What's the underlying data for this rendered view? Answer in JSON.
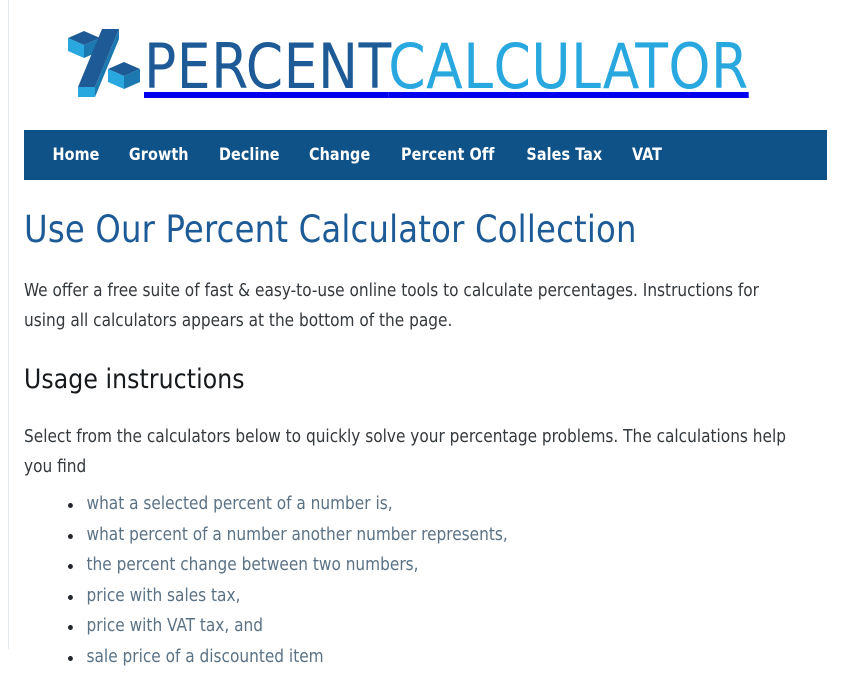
{
  "site": {
    "logo": {
      "icon": "percent-3d-icon",
      "word_primary": "PERCENT",
      "word_secondary": "CALCULATOR",
      "color_primary": "#1e5b96",
      "color_secondary": "#29a8df",
      "icon_top_color": "#1e5b96",
      "icon_side_color": "#29a8df"
    }
  },
  "nav": {
    "background": "#0f5288",
    "items": [
      {
        "label": "Home"
      },
      {
        "label": "Growth"
      },
      {
        "label": "Decline"
      },
      {
        "label": "Change"
      },
      {
        "label": "Percent Off"
      },
      {
        "label": "Sales Tax"
      },
      {
        "label": "VAT"
      }
    ]
  },
  "main": {
    "page_title": "Use Our Percent Calculator Collection",
    "page_title_color": "#1d5b96",
    "intro_paragraph": "We offer a free suite of fast & easy-to-use online tools to calculate percentages. Instructions for using all calculators appears at the bottom of the page.",
    "usage_heading": "Usage instructions",
    "select_paragraph": "Select from the calculators below to quickly solve your percentage problems. The calculations help you find",
    "usage_list": [
      {
        "label": "what a selected percent of a number is,"
      },
      {
        "label": "what percent of a number another number represents,"
      },
      {
        "label": "the percent change between two numbers,"
      },
      {
        "label": "price with sales tax,"
      },
      {
        "label": "price with VAT tax, and"
      },
      {
        "label": "sale price of a discounted item"
      }
    ],
    "list_text_color": "#5b7285"
  }
}
